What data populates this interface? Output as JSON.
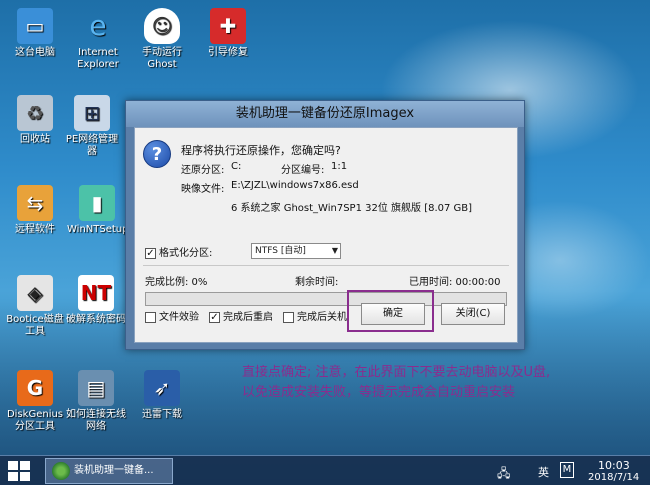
{
  "desktop_icons": [
    {
      "label": "这台电脑",
      "icon": "computer-icon"
    },
    {
      "label": "Internet Explorer",
      "icon": "ie-icon"
    },
    {
      "label": "手动运行 Ghost",
      "icon": "ghost-icon"
    },
    {
      "label": "引导修复",
      "icon": "first-aid-icon"
    },
    {
      "label": "回收站",
      "icon": "recycle-bin-icon"
    },
    {
      "label": "PE网络管理器",
      "icon": "network-icon"
    },
    {
      "label": "远程软件",
      "icon": "remote-icon"
    },
    {
      "label": "WinNTSetup",
      "icon": "winntsetup-icon"
    },
    {
      "label": "Bootice磁盘工具",
      "icon": "bootice-icon"
    },
    {
      "label": "破解系统密码",
      "icon": "nt-password-icon"
    },
    {
      "label": "DiskGenius分区工具",
      "icon": "diskgenius-icon"
    },
    {
      "label": "如何连接无线网络",
      "icon": "wifi-help-icon"
    },
    {
      "label": "迅雷下载",
      "icon": "thunder-icon"
    }
  ],
  "dialog": {
    "title": "装机助理一键备份还原Imagex",
    "question": "程序将执行还原操作，您确定吗?",
    "restore_partition_label": "还原分区:",
    "restore_partition_value": "C:",
    "partition_number_label": "分区编号:",
    "partition_number_value": "1:1",
    "image_file_label": "映像文件:",
    "image_file_value": "E:\\ZJZL\\windows7x86.esd",
    "image_desc": "6  系统之家 Ghost_Win7SP1 32位 旗舰版 [8.07 GB]",
    "format_label": "格式化分区:",
    "format_checked": true,
    "format_select_value": "NTFS [自动]",
    "progress_label": "完成比例: 0%",
    "remaining_label": "剩余时间:",
    "elapsed_label": "已用时间: 00:00:00",
    "progress_value": 0,
    "verify_label": "文件效验",
    "verify_checked": false,
    "reboot_label": "完成后重启",
    "reboot_checked": true,
    "shutdown_label": "完成后关机",
    "shutdown_checked": false,
    "confirm_label": "确定",
    "close_label": "关闭(C)"
  },
  "note": {
    "line1": "直接点确定; 注意，在此界面下不要去动电脑以及U盘,",
    "line2": "以免造成安装失败，等提示完成会自动重启安装"
  },
  "taskbar": {
    "task_label": "装机助理一键备...",
    "ime_label": "英",
    "ime_mode": "M",
    "time": "10:03",
    "date": "2018/7/14"
  },
  "colors": {
    "annotation": "#8a2d8e",
    "progress": "#3aa33a"
  }
}
